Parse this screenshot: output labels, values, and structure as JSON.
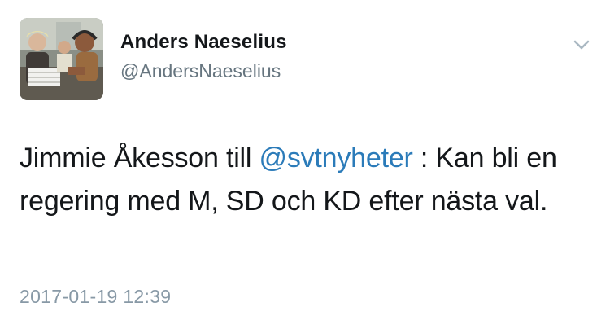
{
  "author": {
    "name": "Anders Naeselius",
    "handle": "@AndersNaeselius",
    "avatar_icon": "profile-photo"
  },
  "menu": {
    "icon": "chevron-down-icon"
  },
  "tweet": {
    "text_before": "Jimmie Åkesson till ",
    "mention": "@svtnyheter",
    "text_after": " : Kan bli en regering med M, SD och KD efter nästa val."
  },
  "timestamp": "2017-01-19 12:39",
  "colors": {
    "text": "#14171a",
    "secondary": "#66757f",
    "link": "#2b7bb9",
    "timestamp": "#8899a6"
  }
}
